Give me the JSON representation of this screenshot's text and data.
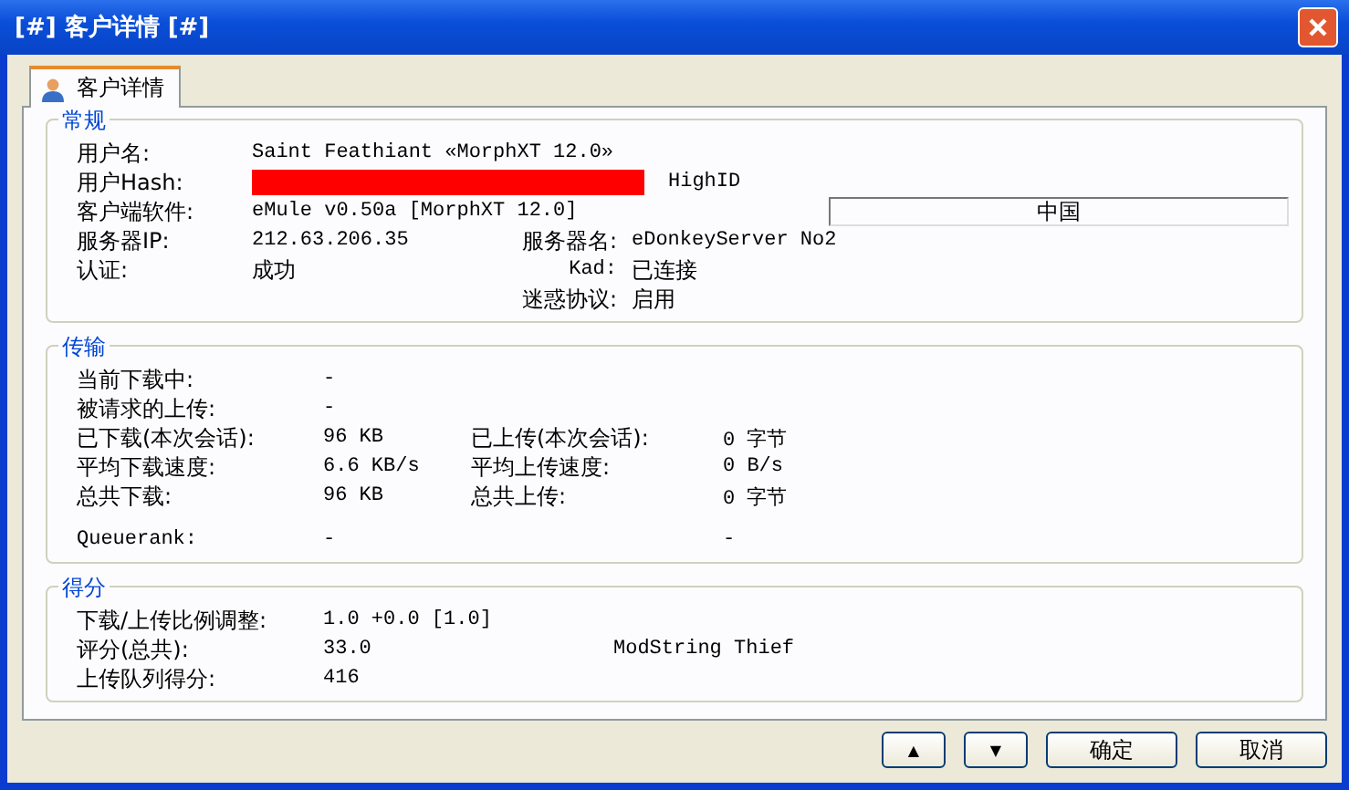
{
  "window": {
    "title": "[#] 客户详情 [#]"
  },
  "tabs": [
    {
      "label": "客户详情",
      "selected": true
    }
  ],
  "general": {
    "title": "常规",
    "user_name": {
      "label": "用户名:",
      "value": "Saint Feathiant «MorphXT 12.0»"
    },
    "user_hash": {
      "label": "用户Hash:",
      "id_type": "HighID"
    },
    "client_software": {
      "label": "客户端软件:",
      "value": "eMule v0.50a [MorphXT 12.0]"
    },
    "country": "中国",
    "server_ip": {
      "label": "服务器IP:",
      "value": "212.63.206.35"
    },
    "server_name": {
      "label": "服务器名:",
      "value": "eDonkeyServer No2"
    },
    "auth": {
      "label": "认证:",
      "value": "成功"
    },
    "kad": {
      "label": "Kad:",
      "value": "已连接"
    },
    "obfuscation": {
      "label": "迷惑协议:",
      "value": "启用"
    }
  },
  "transfer": {
    "title": "传输",
    "rows": [
      {
        "label": "当前下载中:",
        "value": "-"
      },
      {
        "label": "被请求的上传:",
        "value": "-"
      },
      {
        "label": "已下载(本次会话):",
        "value": "96 KB",
        "label_2": "已上传(本次会话):",
        "value_2": "0 字节"
      },
      {
        "label": "平均下载速度:",
        "value": "6.6 KB/s",
        "label_2": "平均上传速度:",
        "value_2": "0 B/s"
      },
      {
        "label": "总共下载:",
        "value": "96 KB",
        "label_2": "总共上传:",
        "value_2": "0 字节"
      },
      {
        "label": "Queuerank:",
        "value": "-",
        "value_2": "-"
      }
    ]
  },
  "score": {
    "title": "得分",
    "rows": [
      {
        "label": "下载/上传比例调整:",
        "value": "1.0 +0.0 [1.0]"
      },
      {
        "label": "评分(总共):",
        "value": "33.0",
        "extra": "ModString Thief"
      },
      {
        "label": "上传队列得分:",
        "value": "416"
      }
    ]
  },
  "buttons": [
    {
      "kind": "up",
      "label": "▲"
    },
    {
      "kind": "down",
      "label": "▼"
    },
    {
      "kind": "text",
      "label": "确定"
    },
    {
      "kind": "text",
      "label": "取消"
    }
  ]
}
